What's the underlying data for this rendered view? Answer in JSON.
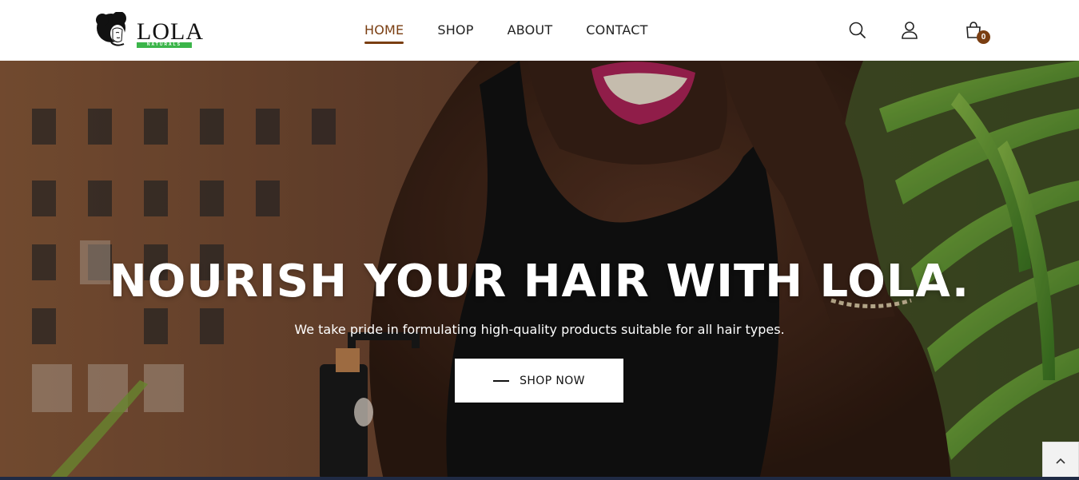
{
  "header": {
    "logo": {
      "name": "LOLA",
      "sub": "NATURALS"
    },
    "nav": [
      {
        "label": "HOME",
        "active": true
      },
      {
        "label": "SHOP",
        "active": false
      },
      {
        "label": "ABOUT",
        "active": false
      },
      {
        "label": "CONTACT",
        "active": false
      }
    ],
    "icons": [
      "search-icon",
      "user-icon",
      "cart-icon"
    ],
    "cart_count": "0"
  },
  "hero": {
    "title": "NOURISH YOUR HAIR WITH LOLA.",
    "subtitle": "We take pride in formulating high-quality products suitable for all hair types.",
    "cta_label": "SHOP NOW"
  },
  "colors": {
    "accent": "#7a3e12",
    "logo_green": "#3bb54a",
    "text_dark": "#222222"
  }
}
